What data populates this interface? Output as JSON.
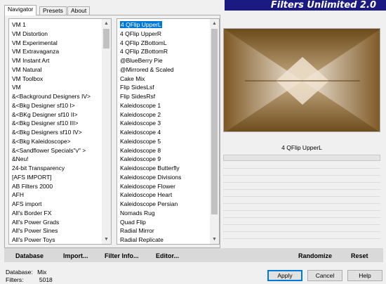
{
  "banner": {
    "title": "Filters Unlimited 2.0"
  },
  "tabs": [
    {
      "label": "Navigator",
      "active": true
    },
    {
      "label": "Presets",
      "active": false
    },
    {
      "label": "About",
      "active": false
    }
  ],
  "category_list": {
    "items": [
      "VM 1",
      "VM Distortion",
      "VM Experimental",
      "VM Extravaganza",
      "VM Instant Art",
      "VM Natural",
      "VM Toolbox",
      "VM",
      "&<Background Designers IV>",
      "&<Bkg Designer sf10 I>",
      "&<BKg Designer sf10 II>",
      "&<Bkg Designer sf10 III>",
      "&<Bkg Designers sf10 IV>",
      "&<Bkg Kaleidoscope>",
      "&<Sandflower Specials\"v\" >",
      "&Neu!",
      "24-bit Transparency",
      "[AFS IMPORT]",
      "AB Filters 2000",
      "AFH",
      "AFS import",
      "All's Border FX",
      "All's Power Grads",
      "All's Power Sines",
      "All's Power Toys"
    ],
    "selected_index": -1
  },
  "filter_list": {
    "items": [
      "4 QFlip UpperL",
      "4 QFlip UpperR",
      "4 QFlip ZBottomL",
      "4 QFlip ZBottomR",
      "@BlueBerry Pie",
      "@Mirrored & Scaled",
      "Cake Mix",
      "Flip SidesLsf",
      "Flip SidesRsf",
      "Kaleidoscope 1",
      "Kaleidoscope 2",
      "Kaleidoscope 3",
      "Kaleidoscope 4",
      "Kaleidoscope 5",
      "Kaleidoscope 8",
      "Kaleidoscope 9",
      "Kaleidoscope Butterfly",
      "Kaleidoscope Divisions",
      "Kaleidoscope Flower",
      "Kaleidoscope Heart",
      "Kaleidoscope Persian",
      "Nomads Rug",
      "Quad Flip",
      "Radial Mirror",
      "Radial Replicate"
    ],
    "selected_index": 0
  },
  "preview": {
    "filter_name": "4 QFlip UpperL"
  },
  "toolbar": {
    "database": "Database",
    "import": "Import...",
    "filter_info": "Filter Info...",
    "editor": "Editor...",
    "randomize": "Randomize",
    "reset": "Reset"
  },
  "info": {
    "database_label": "Database:",
    "database_value": "Mix",
    "filters_label": "Filters:",
    "filters_value": "5018"
  },
  "buttons": {
    "apply": "Apply",
    "cancel": "Cancel",
    "help": "Help"
  },
  "colors": {
    "banner": "#1a1a82",
    "selection": "#0078d7",
    "preview_dark": "#6b4a1a",
    "preview_light": "#f5ece0"
  }
}
